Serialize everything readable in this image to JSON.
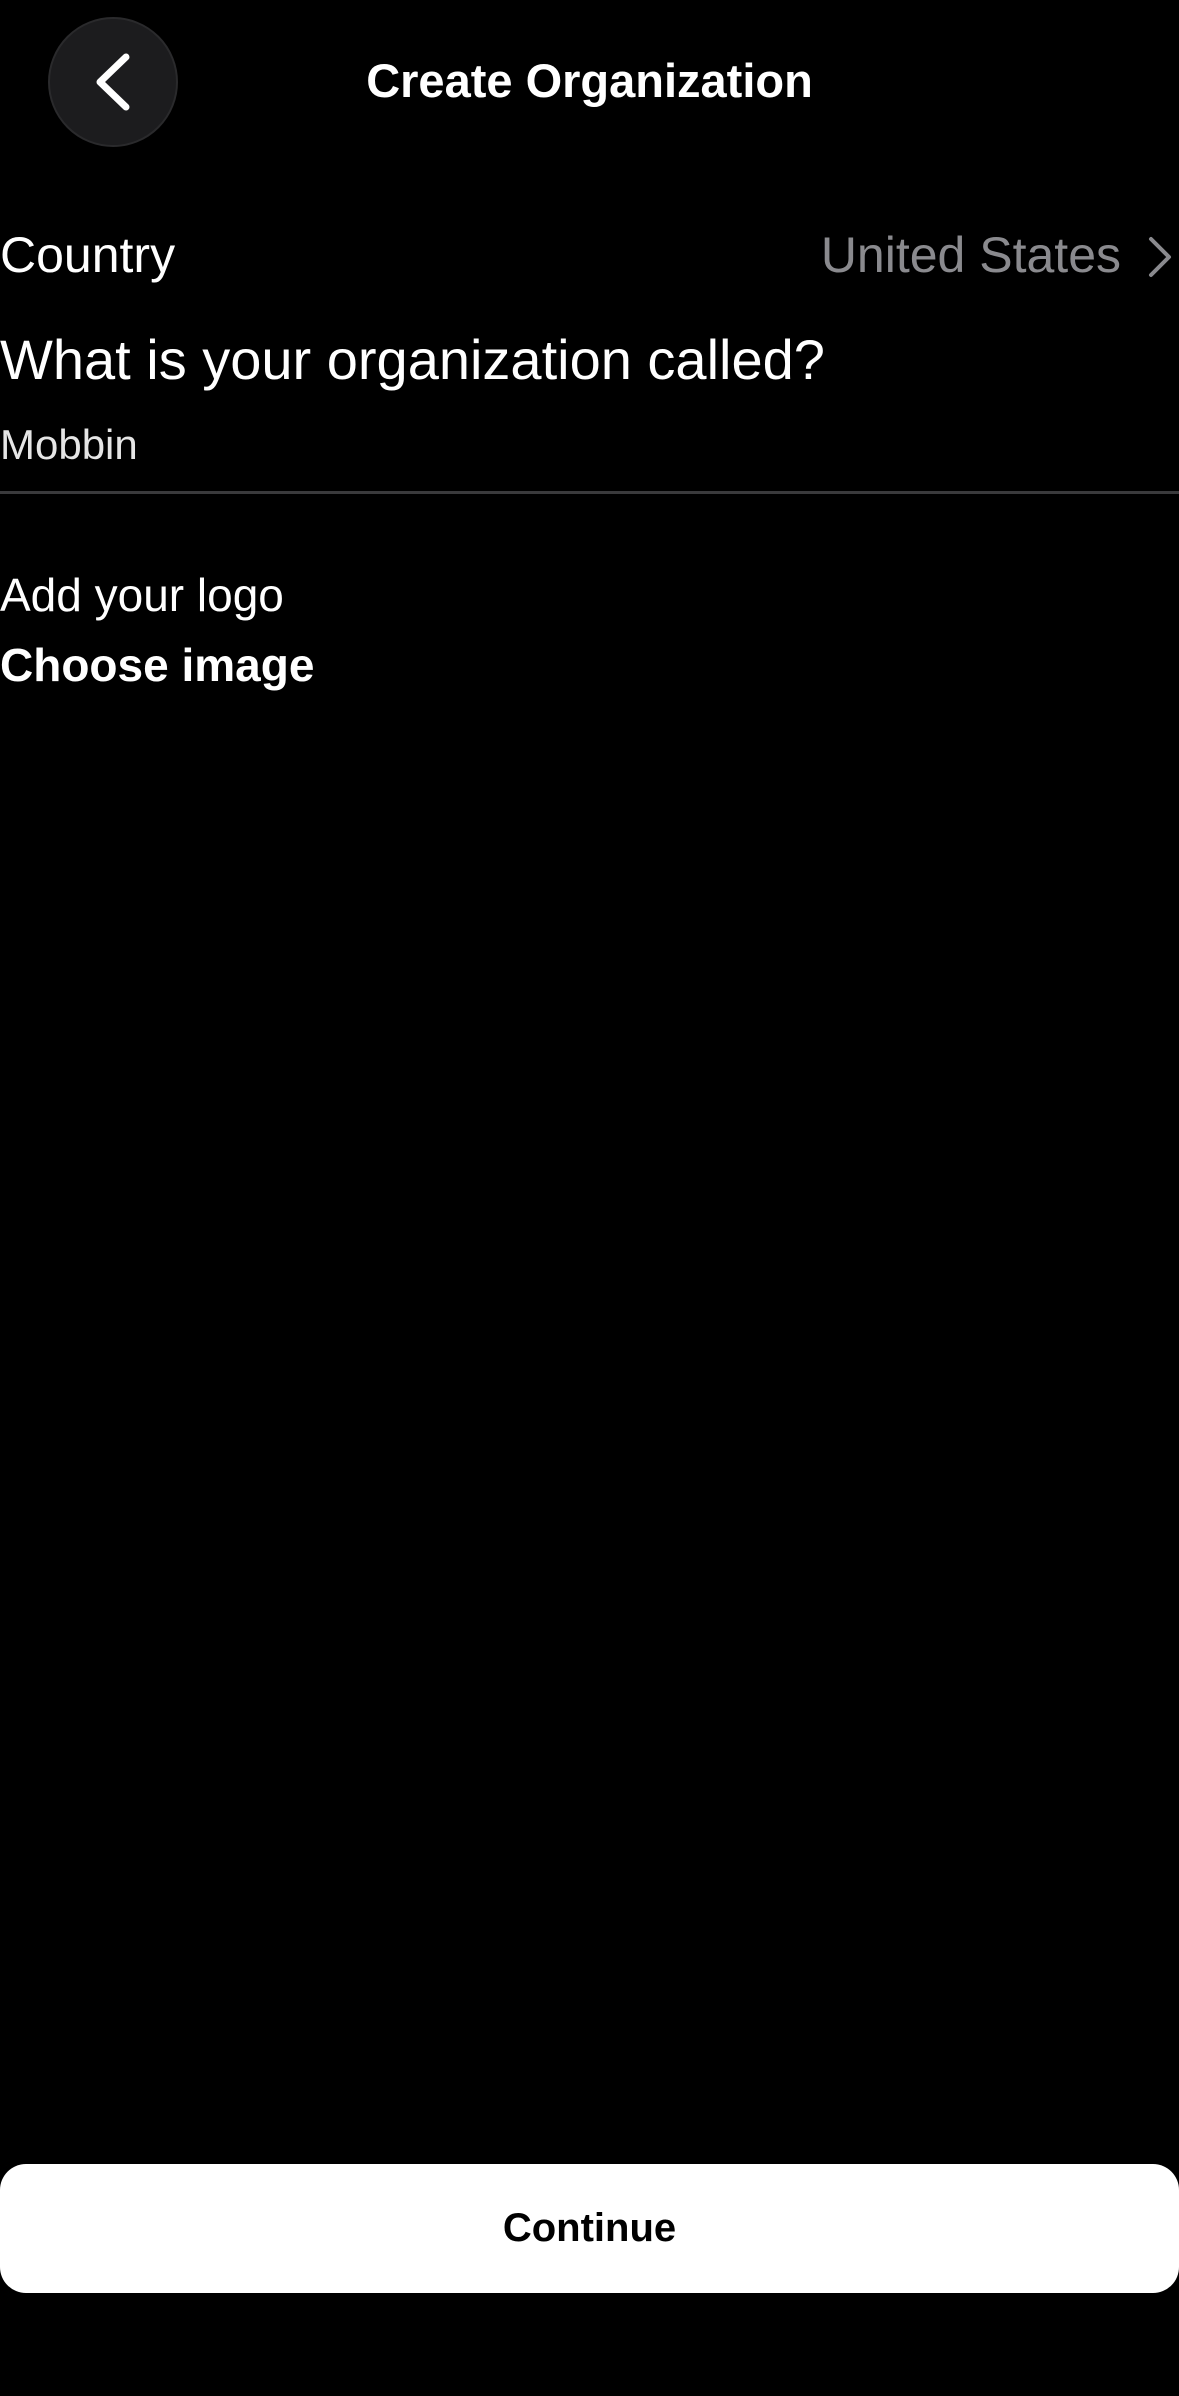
{
  "header": {
    "title": "Create Organization",
    "back_icon": "chevron-left-icon"
  },
  "form": {
    "country_label": "Country",
    "country_value": "United States",
    "country_chevron_icon": "chevron-right-icon",
    "name_question": "What is your organization called?",
    "name_value": "Mobbin",
    "logo_label": "Add your logo",
    "choose_image_label": "Choose image"
  },
  "footer": {
    "continue_label": "Continue"
  },
  "colors": {
    "background": "#000000",
    "text_primary": "#ffffff",
    "text_secondary": "#8a8a8e",
    "button_bg": "#ffffff",
    "button_text": "#000000"
  }
}
